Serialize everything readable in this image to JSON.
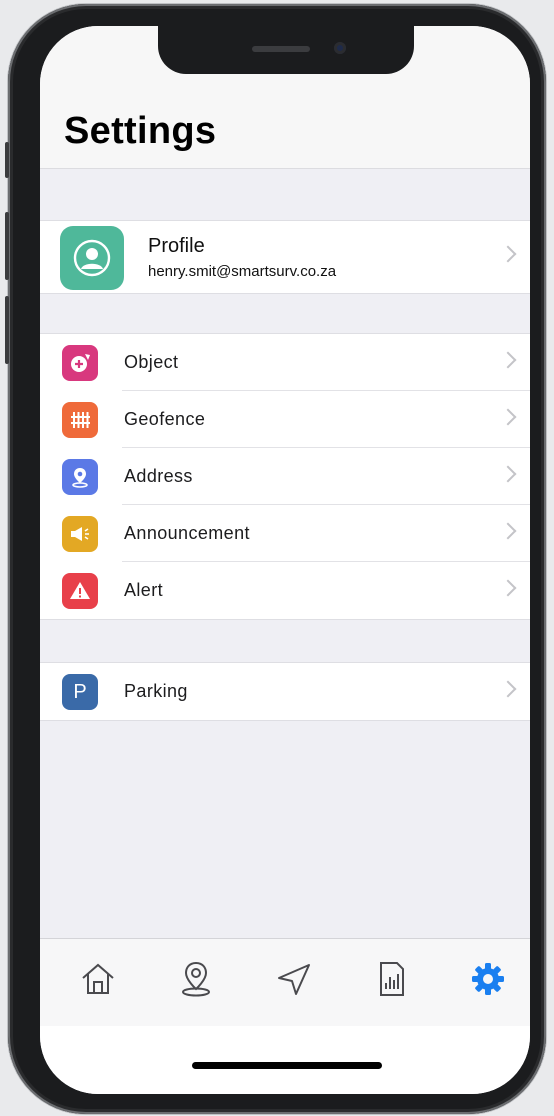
{
  "screen": {
    "title": "Settings"
  },
  "profile": {
    "name": "Profile",
    "email": "henry.smit@smartsurv.co.za",
    "icon": "user-avatar-icon",
    "color": "#4fb89a"
  },
  "menu": [
    {
      "label": "Object",
      "icon": "object-icon",
      "color": "#d8387e"
    },
    {
      "label": "Geofence",
      "icon": "fence-icon",
      "color": "#ef6a3a"
    },
    {
      "label": "Address",
      "icon": "location-pin-icon",
      "color": "#5b79e6"
    },
    {
      "label": "Announcement",
      "icon": "megaphone-icon",
      "color": "#e3a824"
    },
    {
      "label": "Alert",
      "icon": "warning-icon",
      "color": "#e8404a"
    }
  ],
  "parking": {
    "label": "Parking",
    "icon_letter": "P",
    "color": "#3a6aa8"
  },
  "tabbar": {
    "items": [
      "home-tab",
      "location-tab",
      "navigation-tab",
      "reports-tab",
      "settings-tab"
    ],
    "active_color": "#1a7ff0",
    "inactive_color": "#4a4a4e"
  }
}
